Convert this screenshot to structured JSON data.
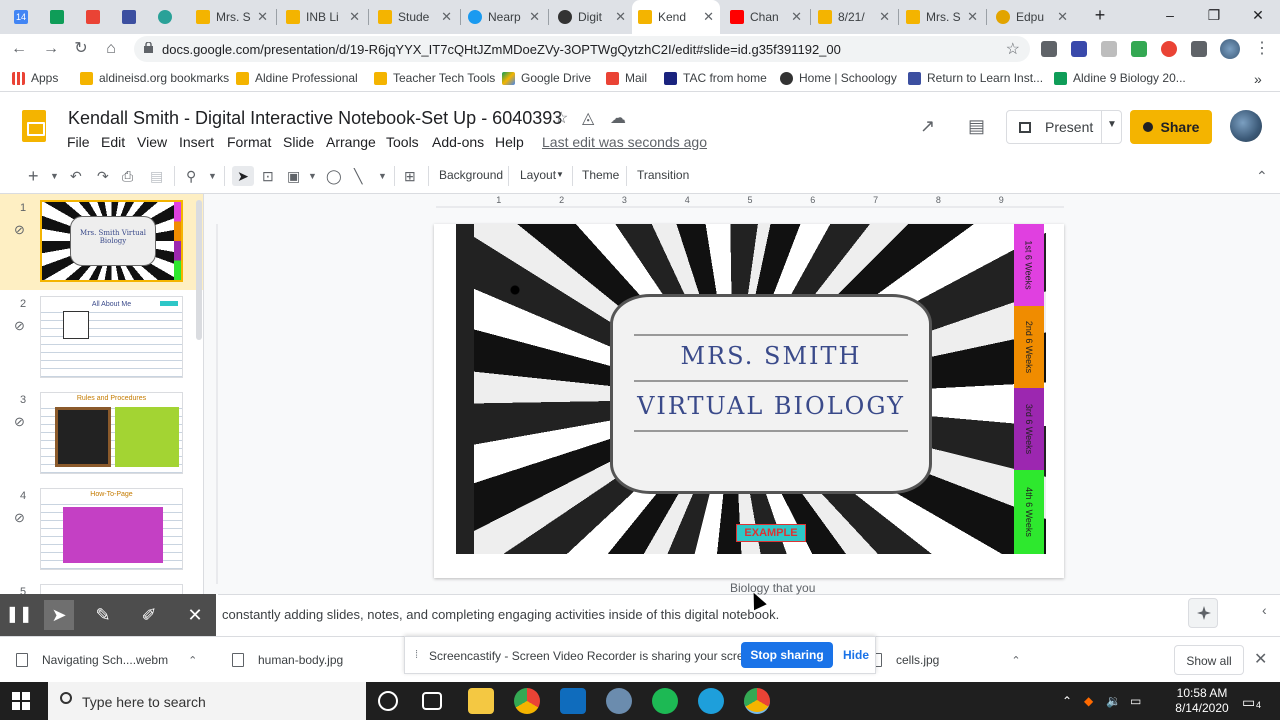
{
  "browser": {
    "tabs": [
      {
        "label": "14",
        "color": "#4285f4"
      },
      {
        "label": "",
        "color": "#0f9d58"
      },
      {
        "label": "",
        "color": "#ea4335"
      },
      {
        "label": "",
        "color": "#3c4fa0"
      },
      {
        "label": "",
        "color": "#2aa198"
      },
      {
        "label": "Mrs. S",
        "color": "#f4b400"
      },
      {
        "label": "INB Li",
        "color": "#f4b400"
      },
      {
        "label": "Stude",
        "color": "#f4b400"
      },
      {
        "label": "Nearp",
        "color": "#1a9af0"
      },
      {
        "label": "Digit",
        "color": "#333333"
      },
      {
        "label": "Kend",
        "color": "#f4b400"
      },
      {
        "label": "Chan",
        "color": "#ff0000"
      },
      {
        "label": "8/21/",
        "color": "#f4b400"
      },
      {
        "label": "Mrs. S",
        "color": "#f4b400"
      },
      {
        "label": "Edpu",
        "color": "#e2a400"
      }
    ],
    "new_tab": "+",
    "window_controls": [
      "–",
      "❐",
      "✕"
    ],
    "url": "docs.google.com/presentation/d/19-R6jqYYX_IT7cQHtJZmMDoeZVy-3OPTWgQytzhC2I/edit#slide=id.g35f391192_00",
    "bookmarks": [
      {
        "label": "Apps",
        "color": "#5f6368"
      },
      {
        "label": "aldineisd.org bookmarks",
        "color": "#f4b400"
      },
      {
        "label": "Aldine Professional",
        "color": "#f4b400"
      },
      {
        "label": "Teacher Tech Tools",
        "color": "#f4b400"
      },
      {
        "label": "Google Drive",
        "color": "#0f9d58"
      },
      {
        "label": "Mail",
        "color": "#ea4335"
      },
      {
        "label": "TAC from home",
        "color": "#1a237e"
      },
      {
        "label": "Home | Schoology",
        "color": "#333333"
      },
      {
        "label": "Return to Learn Inst...",
        "color": "#3c4fa0"
      },
      {
        "label": "Aldine 9 Biology 20...",
        "color": "#0f9d58"
      }
    ]
  },
  "slides": {
    "doc_title": "Kendall Smith - Digital Interactive Notebook-Set Up - 6040393",
    "menu": [
      "File",
      "Edit",
      "View",
      "Insert",
      "Format",
      "Slide",
      "Arrange",
      "Tools",
      "Add-ons",
      "Help"
    ],
    "last_edit": "Last edit was seconds ago",
    "present_label": "Present",
    "share_label": "Share",
    "toolbar_text": [
      "Background",
      "Layout",
      "Theme",
      "Transition"
    ],
    "filmstrip_numbers": [
      "1",
      "2",
      "3",
      "4",
      "5"
    ],
    "thumb_titles": [
      "Mrs. Smith Virtual Biology",
      "All About Me",
      "Rules and Procedures",
      "How-To-Page"
    ],
    "ruler_ticks": [
      "1",
      "2",
      "3",
      "4",
      "5",
      "6",
      "7",
      "8",
      "9"
    ],
    "slide_line1": "MRS. SMITH",
    "slide_line2": "VIRTUAL BIOLOGY",
    "side_tabs": [
      "1st 6 Weeks",
      "2nd 6 Weeks",
      "3rd 6 Weeks",
      "4th 6 Weeks"
    ],
    "side_tab_colors": [
      "#e040e0",
      "#f08c00",
      "#9c27b0",
      "#2ee82e"
    ],
    "example_tag": "EXAMPLE",
    "notes_text": "constantly adding slides, notes, and completing engaging activities inside of this digital notebook.",
    "notes_hint": "Biology that you"
  },
  "screencastify": {
    "tools": [
      "pause",
      "pointer",
      "pen",
      "highlighter",
      "close"
    ],
    "share_message": "Screencastify - Screen Video Recorder is sharing your screen.",
    "stop_label": "Stop sharing",
    "hide_label": "Hide"
  },
  "downloads": {
    "items": [
      "Navigating Sch....webm",
      "human-body.jpg",
      "cells.jpg"
    ],
    "show_all": "Show all"
  },
  "taskbar": {
    "search_placeholder": "Type here to search",
    "time": "10:58 AM",
    "date": "8/14/2020",
    "notif_count": "4"
  }
}
